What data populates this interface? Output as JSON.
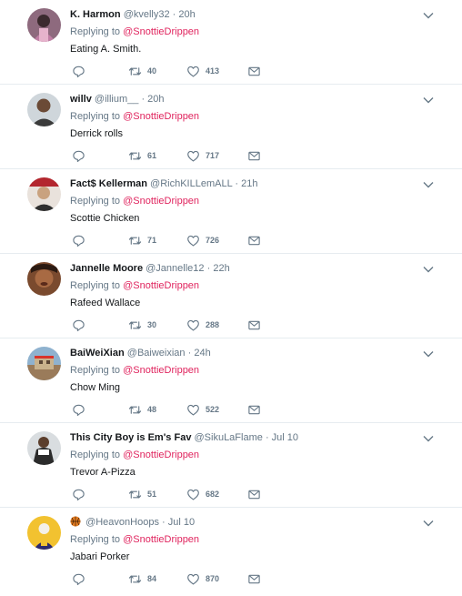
{
  "tweets": [
    {
      "name": "K. Harmon",
      "handle": "@kvelly32",
      "time": "20h",
      "replying_prefix": "Replying to",
      "replying_to": "@SnottieDrippen",
      "text": "Eating A. Smith.",
      "retweets": "40",
      "likes": "413"
    },
    {
      "name": "willv",
      "handle": "@illium__",
      "time": "20h",
      "replying_prefix": "Replying to",
      "replying_to": "@SnottieDrippen",
      "text": "Derrick rolls",
      "retweets": "61",
      "likes": "717"
    },
    {
      "name": "Fact$ Kellerman",
      "handle": "@RichKILLemALL",
      "time": "21h",
      "replying_prefix": "Replying to",
      "replying_to": "@SnottieDrippen",
      "text": "Scottie Chicken",
      "retweets": "71",
      "likes": "726"
    },
    {
      "name": "Jannelle Moore",
      "handle": "@Jannelle12",
      "time": "22h",
      "replying_prefix": "Replying to",
      "replying_to": "@SnottieDrippen",
      "text": "Rafeed Wallace",
      "retweets": "30",
      "likes": "288"
    },
    {
      "name": "BaiWeiXian",
      "handle": "@Baiweixian",
      "time": "24h",
      "replying_prefix": "Replying to",
      "replying_to": "@SnottieDrippen",
      "text": "Chow Ming",
      "retweets": "48",
      "likes": "522"
    },
    {
      "name": "This City Boy is Em's Fav",
      "handle": "@SikuLaFlame",
      "time": "Jul 10",
      "replying_prefix": "Replying to",
      "replying_to": "@SnottieDrippen",
      "text": "Trevor A-Pizza",
      "retweets": "51",
      "likes": "682"
    },
    {
      "name": "",
      "name_icon": "basketball-icon",
      "handle": "@HeavonHoops",
      "time": "Jul 10",
      "replying_prefix": "Replying to",
      "replying_to": "@SnottieDrippen",
      "text": "Jabari Porker",
      "retweets": "84",
      "likes": "870"
    }
  ],
  "separator": "·",
  "colors": {
    "mention": "#e0245e",
    "secondary_text": "#657786",
    "primary_text": "#14171a",
    "divider": "#e6ecf0"
  },
  "icons": {
    "reply": "reply-icon",
    "retweet": "retweet-icon",
    "like": "heart-icon",
    "dm": "envelope-icon",
    "more": "chevron-down-icon"
  }
}
